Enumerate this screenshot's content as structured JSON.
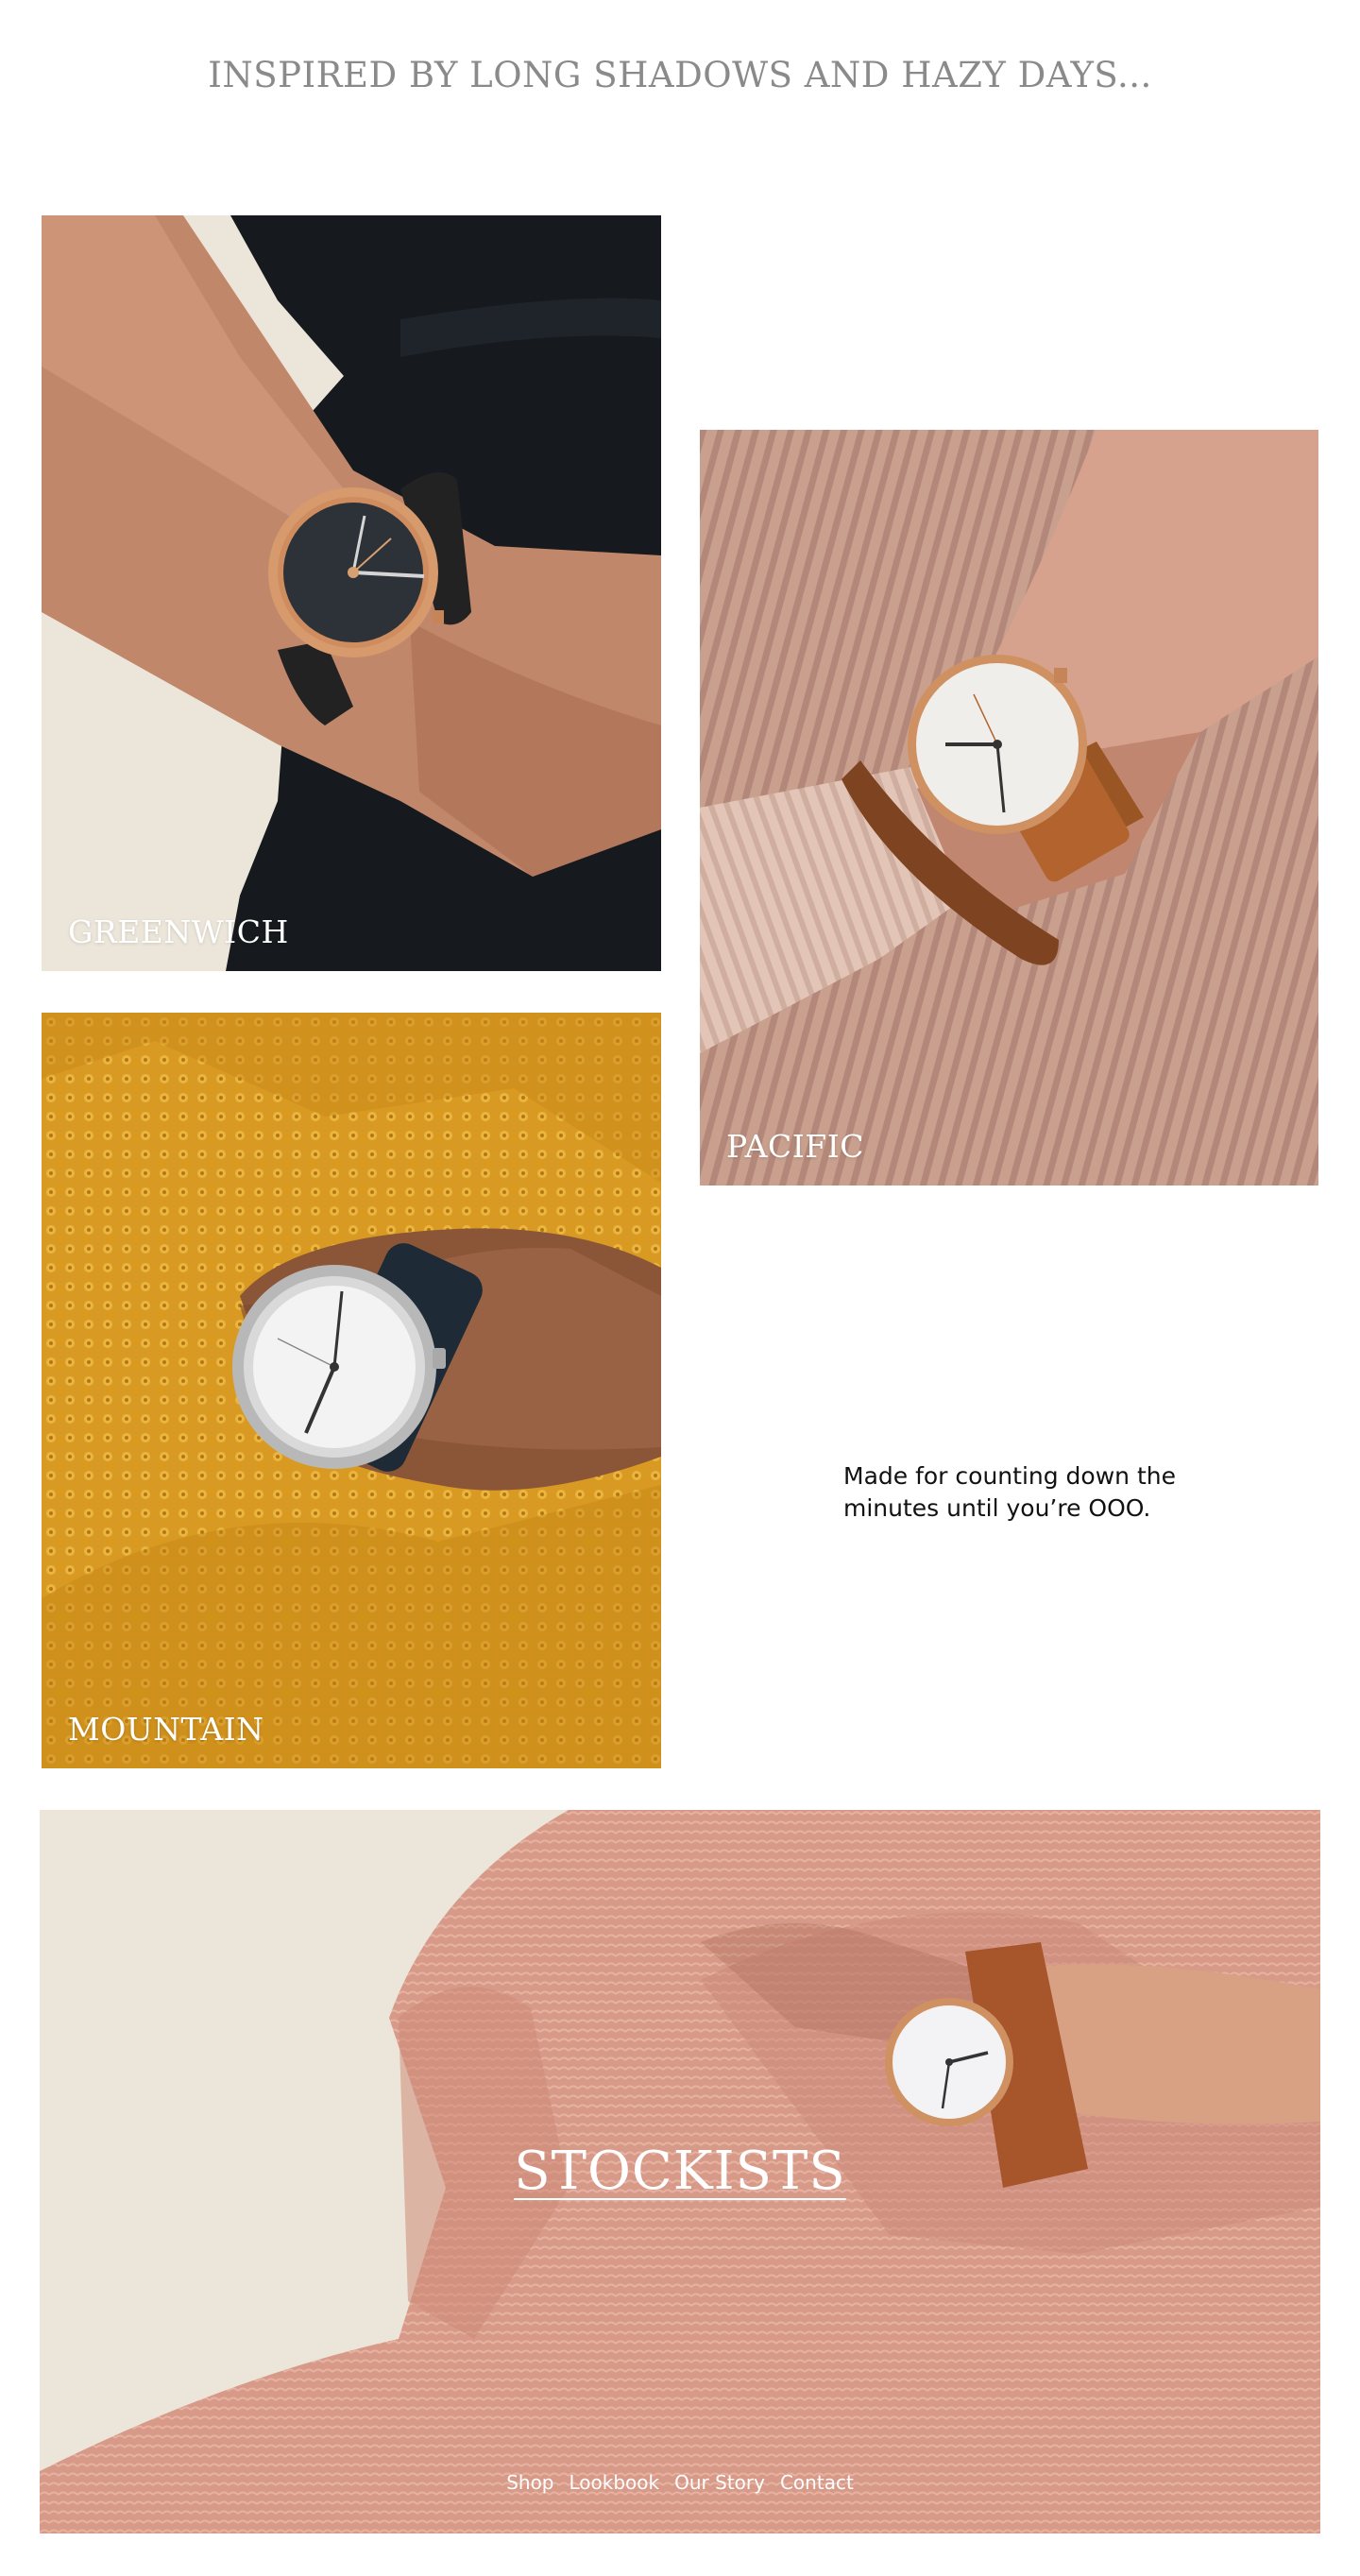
{
  "headline": "INSPIRED BY LONG SHADOWS AND HAZY DAYS...",
  "cards": {
    "greenwich": {
      "label": "GREENWICH"
    },
    "pacific": {
      "label": "PACIFIC"
    },
    "mountain": {
      "label": "MOUNTAIN"
    }
  },
  "tagline": "Made for counting down the minutes until you’re OOO.",
  "hero": {
    "cta": "STOCKISTS"
  },
  "footer_nav": [
    "Shop",
    "Lookbook",
    "Our Story",
    "Contact"
  ],
  "colors": {
    "headline": "#8a8a8a",
    "greenwich_bg": "#ece6da",
    "pacific_bg": "#c9a08e",
    "mountain_bg": "#d89a22",
    "hero_bg": "#d89a88"
  }
}
